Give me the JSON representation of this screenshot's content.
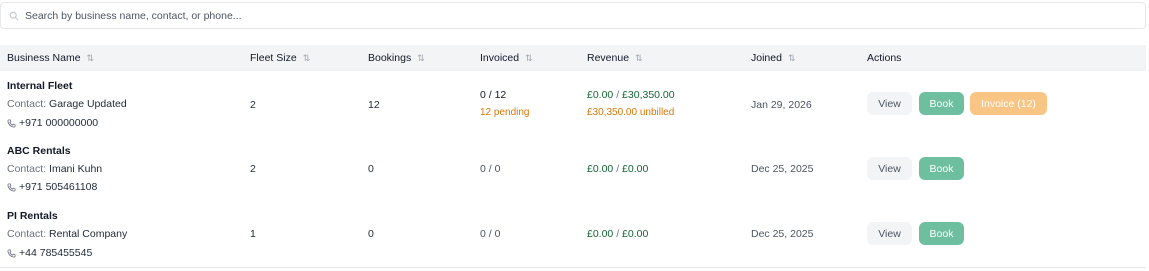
{
  "search": {
    "placeholder": "Search by business name, contact, or phone..."
  },
  "columns": {
    "business_name": "Business Name",
    "fleet_size": "Fleet Size",
    "bookings": "Bookings",
    "invoiced": "Invoiced",
    "revenue": "Revenue",
    "joined": "Joined",
    "actions": "Actions"
  },
  "sort_glyph": "⇅",
  "contact_label": "Contact:",
  "revenue_separator": "/",
  "actions": {
    "view": "View",
    "book": "Book"
  },
  "rows": [
    {
      "name": "Internal Fleet",
      "contact": "Garage Updated",
      "phone": "+971 000000000",
      "fleet_size": "2",
      "bookings": "12",
      "invoiced": "0 / 12",
      "invoiced_note": "12 pending",
      "revenue_invoiced": "£0.00",
      "revenue_total": "£30,350.00",
      "revenue_note": "£30,350.00 unbilled",
      "joined": "Jan 29, 2026",
      "invoice_button": "Invoice (12)"
    },
    {
      "name": "ABC Rentals",
      "contact": "Imani Kuhn",
      "phone": "+971 505461108",
      "fleet_size": "2",
      "bookings": "0",
      "invoiced": "0 / 0",
      "revenue_invoiced": "£0.00",
      "revenue_total": "£0.00",
      "joined": "Dec 25, 2025"
    },
    {
      "name": "PI Rentals",
      "contact": "Rental Company",
      "phone": "+44 785455545",
      "fleet_size": "1",
      "bookings": "0",
      "invoiced": "0 / 0",
      "revenue_invoiced": "£0.00",
      "revenue_total": "£0.00",
      "joined": "Dec 25, 2025"
    }
  ],
  "colors": {
    "book_button": "#6dbf9f",
    "invoice_button": "#f8c584",
    "pending_text": "#d97706",
    "revenue_text": "#166534"
  }
}
